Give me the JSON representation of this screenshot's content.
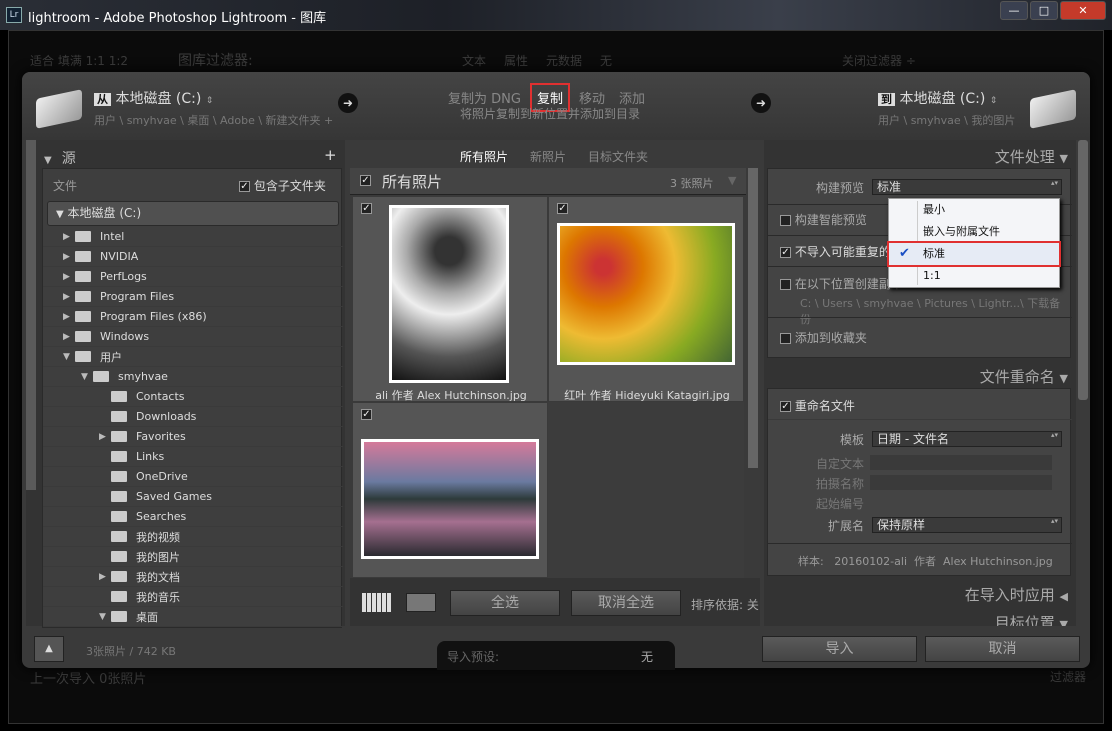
{
  "window": {
    "title": "lightroom - Adobe Photoshop Lightroom - 图库",
    "app_icon": "Lr",
    "controls": [
      "minimize",
      "maximize",
      "close"
    ]
  },
  "background": {
    "view_modes": "适合  填满  1:1  1:2",
    "filter_label": "图库过滤器:",
    "filters": [
      "文本",
      "属性",
      "元数据",
      "无"
    ],
    "close_filter": "关闭过滤器 ÷",
    "last_import": "上一次导入  0张照片",
    "filter_right": "过滤器"
  },
  "header": {
    "source": {
      "badge": "从",
      "drive": "本地磁盘 (C:)",
      "path": "用户 \\ smyhvae \\ 桌面 \\ Adobe \\ 新建文件夹 +"
    },
    "modes": [
      "复制为 DNG",
      "复制",
      "移动",
      "添加"
    ],
    "active_mode": "复制",
    "mode_desc": "将照片复制到新位置并添加到目录",
    "dest": {
      "badge": "到",
      "drive": "本地磁盘 (C:)",
      "path": "用户 \\ smyhvae \\ 我的图片"
    }
  },
  "source_panel": {
    "title": "源",
    "files_label": "文件",
    "include_subfolders": "包含子文件夹",
    "include_checked": true,
    "drive": "本地磁盘 (C:)",
    "folders": [
      {
        "name": "Intel",
        "level": 1,
        "exp": "closed"
      },
      {
        "name": "NVIDIA",
        "level": 1,
        "exp": "closed"
      },
      {
        "name": "PerfLogs",
        "level": 1,
        "exp": "closed"
      },
      {
        "name": "Program Files",
        "level": 1,
        "exp": "closed"
      },
      {
        "name": "Program Files (x86)",
        "level": 1,
        "exp": "closed"
      },
      {
        "name": "Windows",
        "level": 1,
        "exp": "closed"
      },
      {
        "name": "用户",
        "level": 1,
        "exp": "open"
      },
      {
        "name": "smyhvae",
        "level": 2,
        "exp": "open"
      },
      {
        "name": "Contacts",
        "level": 3,
        "exp": ""
      },
      {
        "name": "Downloads",
        "level": 3,
        "exp": ""
      },
      {
        "name": "Favorites",
        "level": 3,
        "exp": "closed"
      },
      {
        "name": "Links",
        "level": 3,
        "exp": ""
      },
      {
        "name": "OneDrive",
        "level": 3,
        "exp": ""
      },
      {
        "name": "Saved Games",
        "level": 3,
        "exp": ""
      },
      {
        "name": "Searches",
        "level": 3,
        "exp": ""
      },
      {
        "name": "我的视频",
        "level": 3,
        "exp": ""
      },
      {
        "name": "我的图片",
        "level": 3,
        "exp": ""
      },
      {
        "name": "我的文档",
        "level": 3,
        "exp": "closed"
      },
      {
        "name": "我的音乐",
        "level": 3,
        "exp": ""
      },
      {
        "name": "桌面",
        "level": 3,
        "exp": "open"
      }
    ]
  },
  "center": {
    "tabs": [
      "所有照片",
      "新照片",
      "目标文件夹"
    ],
    "active_tab": "所有照片",
    "grid_title": "所有照片",
    "count": "3 张照片",
    "photos": [
      {
        "caption": "ali 作者 Alex Hutchinson.jpg",
        "checked": true
      },
      {
        "caption": "红叶 作者 Hideyuki Katagiri.jpg",
        "checked": true
      },
      {
        "caption": "",
        "checked": true
      }
    ],
    "select_all": "全选",
    "deselect_all": "取消全选",
    "sort_label": "排序依据:",
    "sort_value": "关"
  },
  "right": {
    "file_handling": {
      "title": "文件处理",
      "build_preview_label": "构建预览",
      "build_preview_value": "标准",
      "smart_preview": "构建智能预览",
      "no_duplicates": "不导入可能重复的照片",
      "second_copy": "在以下位置创建副本:",
      "second_copy_path": "C: \\ Users \\ smyhvae \\ Pictures \\ Lightr...\\ 下载备份",
      "add_collection": "添加到收藏夹"
    },
    "dropdown": {
      "options": [
        "最小",
        "嵌入与附属文件",
        "标准",
        "1:1"
      ],
      "selected": "标准"
    },
    "rename": {
      "title": "文件重命名",
      "rename_files": "重命名文件",
      "template_label": "模板",
      "template_value": "日期 - 文件名",
      "custom_text": "自定文本",
      "shoot_name": "拍摄名称",
      "start_number": "起始编号",
      "extension_label": "扩展名",
      "extension_value": "保持原样",
      "sample": "样本:   20160102-ali  作者  Alex Hutchinson.jpg"
    },
    "apply_title": "在导入时应用",
    "dest_title": "目标位置"
  },
  "footer": {
    "info": "3张照片 / 742 KB",
    "preset_label": "导入预设:",
    "preset_value": "无",
    "import": "导入",
    "cancel": "取消"
  },
  "colors": {
    "highlight": "#e03030",
    "checkmark": "#1a4fc4"
  }
}
